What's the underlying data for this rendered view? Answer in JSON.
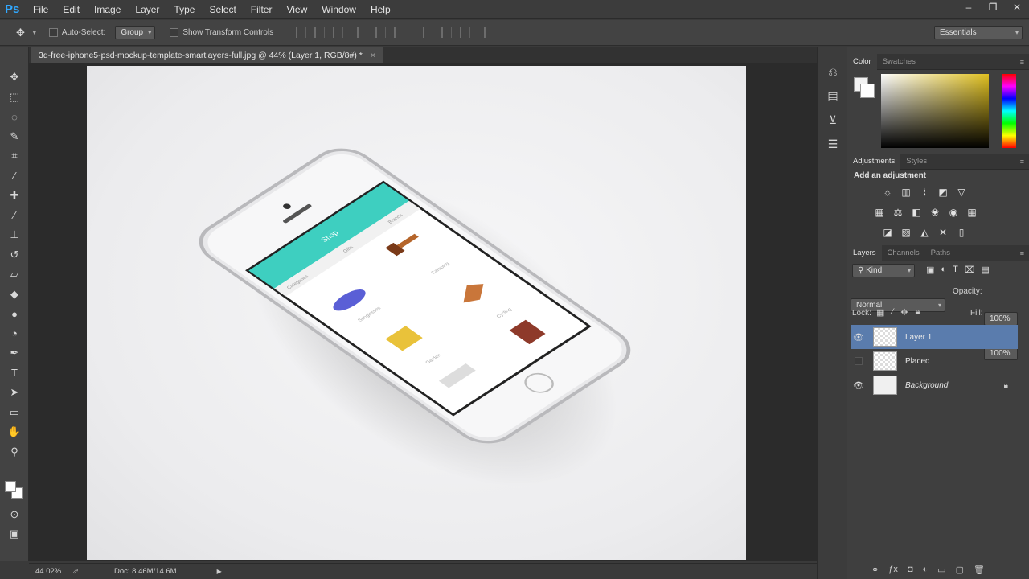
{
  "app": {
    "logo": "Ps"
  },
  "menu": [
    "File",
    "Edit",
    "Image",
    "Layer",
    "Type",
    "Select",
    "Filter",
    "View",
    "Window",
    "Help"
  ],
  "window_controls": [
    "–",
    "❐",
    "✕"
  ],
  "options": {
    "auto_select_label": "Auto-Select:",
    "auto_select_value": "Group",
    "transform_label": "Show Transform Controls",
    "workspace": "Essentials"
  },
  "document": {
    "tab_title": "3d-free-iphone5-psd-mockup-template-smartlayers-full.jpg @ 44% (Layer 1, RGB/8#) *",
    "close": "×"
  },
  "screen_app": {
    "header": "Shop",
    "tabs": [
      "Categories",
      "Gifts",
      "Brands"
    ],
    "items": [
      "Sunglasses",
      "Camping",
      "Garden",
      "Cycling"
    ]
  },
  "status": {
    "zoom": "44.02%",
    "doc": "Doc: 8.46M/14.6M"
  },
  "panels": {
    "color_tabs": [
      "Color",
      "Swatches"
    ],
    "adjust_tabs": [
      "Adjustments",
      "Styles"
    ],
    "add_adjustment": "Add an adjustment",
    "layers_tabs": [
      "Layers",
      "Channels",
      "Paths"
    ],
    "kind": "Kind",
    "blend_mode": "Normal",
    "opacity_label": "Opacity:",
    "opacity_value": "100%",
    "lock_label": "Lock:",
    "fill_label": "Fill:",
    "fill_value": "100%",
    "layers": [
      {
        "name": "Layer 1",
        "visible": true,
        "selected": true
      },
      {
        "name": "Placed",
        "visible": false,
        "selected": false
      },
      {
        "name": "Background",
        "visible": true,
        "selected": false
      }
    ]
  },
  "colors": {
    "accent": "#31a8ff",
    "selection": "#5a7cad",
    "app_teal": "#3ecfc0"
  }
}
